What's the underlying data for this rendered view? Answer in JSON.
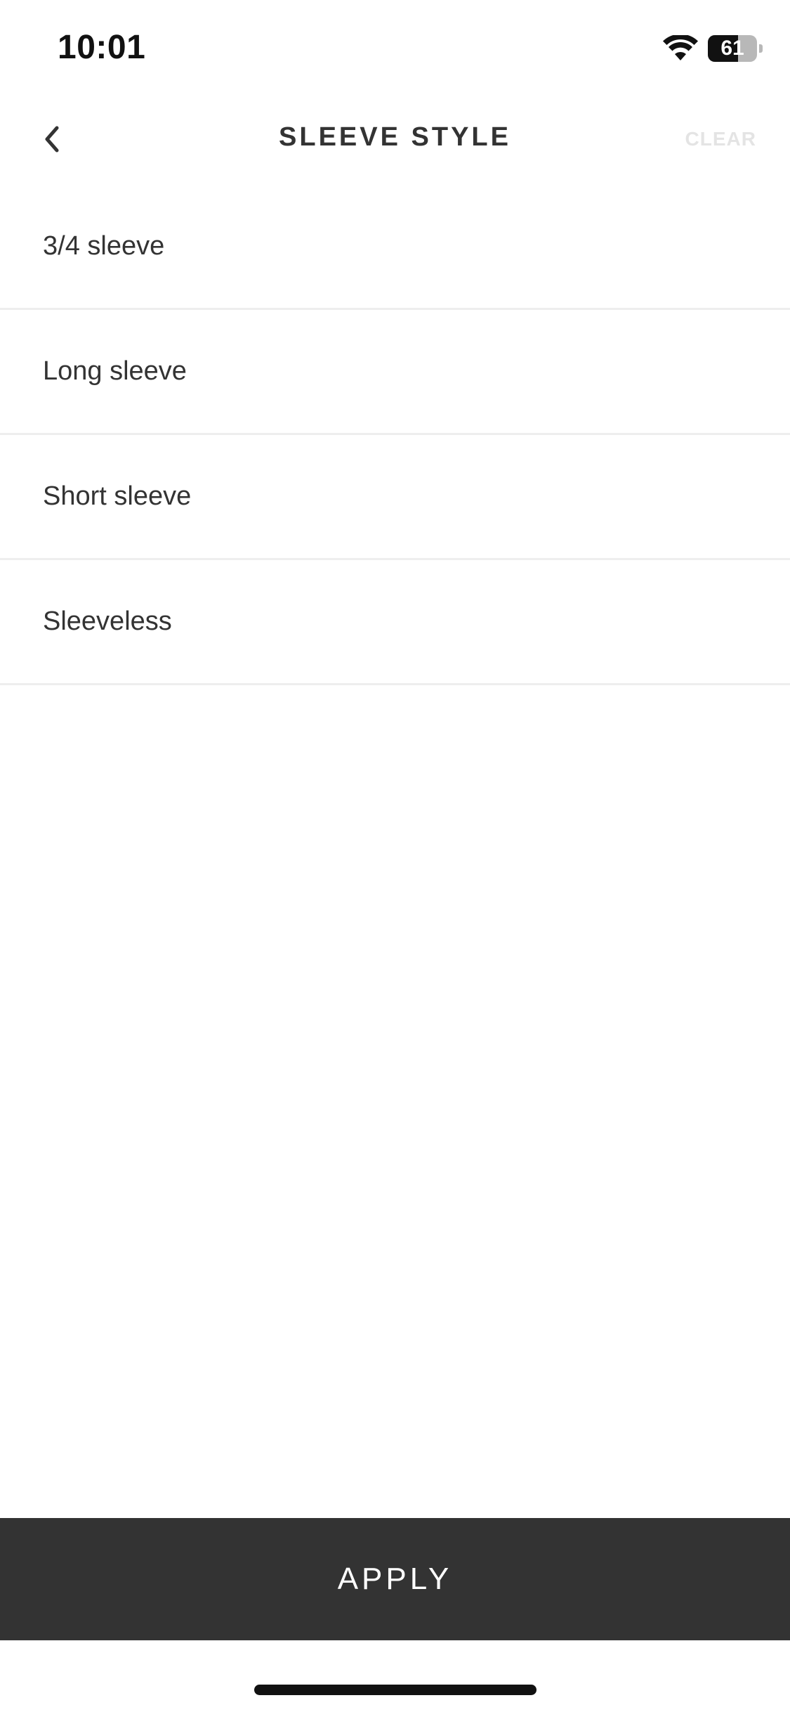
{
  "status_bar": {
    "time": "10:01",
    "battery_level": "61",
    "battery_fraction": 0.61,
    "icons": [
      "wifi-icon",
      "battery-icon"
    ]
  },
  "header": {
    "back_icon": "chevron-left-icon",
    "title": "SLEEVE STYLE",
    "clear_label": "CLEAR"
  },
  "options": [
    {
      "label": "3/4 sleeve"
    },
    {
      "label": "Long sleeve"
    },
    {
      "label": "Short sleeve"
    },
    {
      "label": "Sleeveless"
    }
  ],
  "footer": {
    "apply_label": "APPLY"
  },
  "colors": {
    "apply_background": "#333333",
    "clear_text": "#e4e4e4",
    "divider": "#eeeeee"
  }
}
